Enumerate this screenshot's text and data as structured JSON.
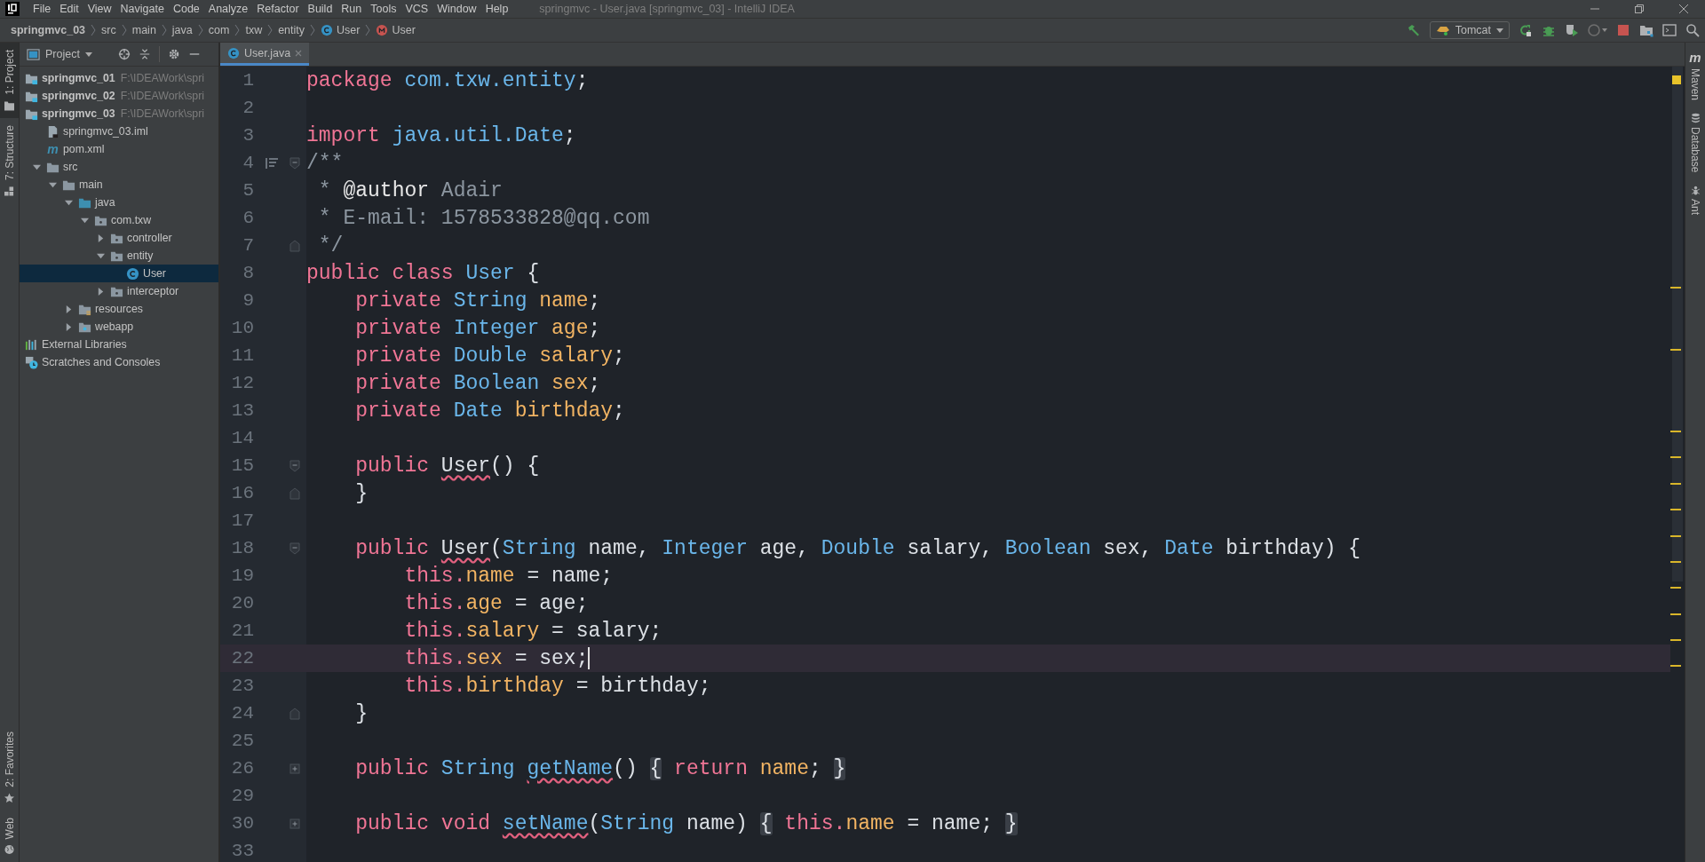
{
  "menu": [
    "File",
    "Edit",
    "View",
    "Navigate",
    "Code",
    "Analyze",
    "Refactor",
    "Build",
    "Run",
    "Tools",
    "VCS",
    "Window",
    "Help"
  ],
  "window": {
    "title": "springmvc - User.java [springmvc_03] - IntelliJ IDEA"
  },
  "breadcrumbs": [
    {
      "label": "springmvc_03",
      "kind": "project"
    },
    {
      "label": "src",
      "kind": "folder"
    },
    {
      "label": "main",
      "kind": "folder"
    },
    {
      "label": "java",
      "kind": "folder"
    },
    {
      "label": "com",
      "kind": "folder"
    },
    {
      "label": "txw",
      "kind": "folder"
    },
    {
      "label": "entity",
      "kind": "folder"
    },
    {
      "label": "User",
      "kind": "class"
    },
    {
      "label": "User",
      "kind": "method"
    }
  ],
  "run_config": {
    "label": "Tomcat"
  },
  "left_tools_top": [
    {
      "label": "1: Project",
      "kind": "project",
      "selected": true
    },
    {
      "label": "7: Structure",
      "kind": "structure",
      "selected": false
    }
  ],
  "left_tools_bottom": [
    {
      "label": "2: Favorites",
      "kind": "favorites",
      "selected": false
    },
    {
      "label": "Web",
      "kind": "web",
      "selected": false
    }
  ],
  "right_tools": [
    {
      "label": "Maven",
      "kind": "maven",
      "glyph": "m"
    },
    {
      "label": "Database",
      "kind": "database"
    },
    {
      "label": "Ant",
      "kind": "ant"
    }
  ],
  "project": {
    "title": "Project",
    "tree": [
      {
        "label": "springmvc_01",
        "path": "F:\\IDEAWork\\spri",
        "kind": "module",
        "selected": false
      },
      {
        "label": "springmvc_02",
        "path": "F:\\IDEAWork\\spri",
        "kind": "module",
        "selected": false
      },
      {
        "label": "springmvc_03",
        "path": "F:\\IDEAWork\\spri",
        "kind": "module",
        "selected": false,
        "children": [
          {
            "label": "springmvc_03.iml",
            "kind": "iml",
            "selected": false
          },
          {
            "label": "pom.xml",
            "kind": "maven",
            "glyph": "m",
            "selected": false
          },
          {
            "label": "src",
            "kind": "folder",
            "expanded": true,
            "selected": false,
            "children": [
              {
                "label": "main",
                "kind": "folder",
                "expanded": true,
                "selected": false,
                "children": [
                  {
                    "label": "java",
                    "kind": "source",
                    "expanded": true,
                    "selected": false,
                    "children": [
                      {
                        "label": "com.txw",
                        "kind": "package",
                        "expanded": true,
                        "selected": false,
                        "children": [
                          {
                            "label": "controller",
                            "kind": "package",
                            "expanded": false,
                            "selected": false
                          },
                          {
                            "label": "entity",
                            "kind": "package",
                            "expanded": true,
                            "selected": false,
                            "children": [
                              {
                                "label": "User",
                                "kind": "class",
                                "selected": true
                              }
                            ]
                          },
                          {
                            "label": "interceptor",
                            "kind": "package",
                            "expanded": false,
                            "selected": false
                          }
                        ]
                      }
                    ]
                  },
                  {
                    "label": "resources",
                    "kind": "resources",
                    "expanded": false,
                    "selected": false
                  },
                  {
                    "label": "webapp",
                    "kind": "webapp",
                    "expanded": false,
                    "selected": false
                  }
                ]
              }
            ]
          }
        ]
      },
      {
        "label": "External Libraries",
        "kind": "libraries",
        "selected": false
      },
      {
        "label": "Scratches and Consoles",
        "kind": "scratches",
        "selected": false
      }
    ]
  },
  "tabs": [
    {
      "label": "User.java",
      "selected": true
    }
  ],
  "lines": [
    {
      "number": "1",
      "kind": "plain",
      "current": false,
      "tokens": [
        {
          "text": "package ",
          "kind": "kw"
        },
        {
          "text": "com.txw.entity",
          "kind": "type"
        },
        {
          "text": ";",
          "kind": "plain"
        }
      ]
    },
    {
      "number": "2",
      "kind": "plain",
      "current": false
    },
    {
      "number": "3",
      "kind": "plain",
      "current": false,
      "tokens": [
        {
          "text": "import ",
          "kind": "kw"
        },
        {
          "text": "java.util.Date",
          "kind": "type"
        },
        {
          "text": ";",
          "kind": "plain"
        }
      ]
    },
    {
      "number": "4",
      "kind": "fold-start",
      "current": false,
      "doc_toggle": true,
      "tokens": [
        {
          "text": "/**",
          "kind": "comment"
        }
      ]
    },
    {
      "number": "5",
      "kind": "plain",
      "current": false,
      "tokens": [
        {
          "text": " * ",
          "kind": "comment"
        },
        {
          "text": "@author",
          "kind": "doctag"
        },
        {
          "text": " Adair",
          "kind": "comment"
        }
      ]
    },
    {
      "number": "6",
      "kind": "plain",
      "current": false,
      "tokens": [
        {
          "text": " * E-mail: 1578533828@qq.com",
          "kind": "comment"
        }
      ]
    },
    {
      "number": "7",
      "kind": "fold-end",
      "current": false,
      "tokens": [
        {
          "text": " */",
          "kind": "comment"
        }
      ]
    },
    {
      "number": "8",
      "kind": "plain",
      "current": false,
      "tokens": [
        {
          "text": "public class ",
          "kind": "kw"
        },
        {
          "text": "User",
          "kind": "type"
        },
        {
          "text": " {",
          "kind": "plain"
        }
      ]
    },
    {
      "number": "9",
      "kind": "plain",
      "current": false,
      "tokens": [
        {
          "text": "    private ",
          "kind": "kw"
        },
        {
          "text": "String ",
          "kind": "type"
        },
        {
          "text": "name",
          "kind": "field"
        },
        {
          "text": ";",
          "kind": "plain"
        }
      ]
    },
    {
      "number": "10",
      "kind": "plain",
      "current": false,
      "tokens": [
        {
          "text": "    private ",
          "kind": "kw"
        },
        {
          "text": "Integer ",
          "kind": "type"
        },
        {
          "text": "age",
          "kind": "field"
        },
        {
          "text": ";",
          "kind": "plain"
        }
      ]
    },
    {
      "number": "11",
      "kind": "plain",
      "current": false,
      "tokens": [
        {
          "text": "    private ",
          "kind": "kw"
        },
        {
          "text": "Double ",
          "kind": "type"
        },
        {
          "text": "salary",
          "kind": "field"
        },
        {
          "text": ";",
          "kind": "plain"
        }
      ]
    },
    {
      "number": "12",
      "kind": "plain",
      "current": false,
      "tokens": [
        {
          "text": "    private ",
          "kind": "kw"
        },
        {
          "text": "Boolean ",
          "kind": "type"
        },
        {
          "text": "sex",
          "kind": "field"
        },
        {
          "text": ";",
          "kind": "plain"
        }
      ]
    },
    {
      "number": "13",
      "kind": "plain",
      "current": false,
      "tokens": [
        {
          "text": "    private ",
          "kind": "kw"
        },
        {
          "text": "Date ",
          "kind": "type"
        },
        {
          "text": "birthday",
          "kind": "field"
        },
        {
          "text": ";",
          "kind": "plain"
        }
      ]
    },
    {
      "number": "14",
      "kind": "plain",
      "current": false
    },
    {
      "number": "15",
      "kind": "fold-start",
      "current": false,
      "tokens": [
        {
          "text": "    public ",
          "kind": "kw"
        },
        {
          "text": "User",
          "kind": "ctor"
        },
        {
          "text": "() {",
          "kind": "plain"
        }
      ]
    },
    {
      "number": "16",
      "kind": "fold-end",
      "current": false,
      "tokens": [
        {
          "text": "    }",
          "kind": "plain"
        }
      ]
    },
    {
      "number": "17",
      "kind": "plain",
      "current": false
    },
    {
      "number": "18",
      "kind": "fold-start",
      "current": false,
      "tokens": [
        {
          "text": "    public ",
          "kind": "kw"
        },
        {
          "text": "User",
          "kind": "ctor"
        },
        {
          "text": "(",
          "kind": "plain"
        },
        {
          "text": "String",
          "kind": "type"
        },
        {
          "text": " name, ",
          "kind": "plain"
        },
        {
          "text": "Integer",
          "kind": "type"
        },
        {
          "text": " age, ",
          "kind": "plain"
        },
        {
          "text": "Double",
          "kind": "type"
        },
        {
          "text": " salary, ",
          "kind": "plain"
        },
        {
          "text": "Boolean",
          "kind": "type"
        },
        {
          "text": " sex, ",
          "kind": "plain"
        },
        {
          "text": "Date",
          "kind": "type"
        },
        {
          "text": " birthday) {",
          "kind": "plain"
        }
      ]
    },
    {
      "number": "19",
      "kind": "plain",
      "current": false,
      "tokens": [
        {
          "text": "        this.",
          "kind": "kw"
        },
        {
          "text": "name",
          "kind": "field"
        },
        {
          "text": " = name;",
          "kind": "plain"
        }
      ]
    },
    {
      "number": "20",
      "kind": "plain",
      "current": false,
      "tokens": [
        {
          "text": "        this.",
          "kind": "kw"
        },
        {
          "text": "age",
          "kind": "field"
        },
        {
          "text": " = age;",
          "kind": "plain"
        }
      ]
    },
    {
      "number": "21",
      "kind": "plain",
      "current": false,
      "tokens": [
        {
          "text": "        this.",
          "kind": "kw"
        },
        {
          "text": "salary",
          "kind": "field"
        },
        {
          "text": " = salary;",
          "kind": "plain"
        }
      ]
    },
    {
      "number": "22",
      "kind": "plain",
      "current": true,
      "tokens": [
        {
          "text": "        this.",
          "kind": "kw"
        },
        {
          "text": "sex",
          "kind": "field"
        },
        {
          "text": " = sex;",
          "kind": "plain"
        }
      ]
    },
    {
      "number": "23",
      "kind": "plain",
      "current": false,
      "tokens": [
        {
          "text": "        this.",
          "kind": "kw"
        },
        {
          "text": "birthday",
          "kind": "field"
        },
        {
          "text": " = birthday;",
          "kind": "plain"
        }
      ]
    },
    {
      "number": "24",
      "kind": "fold-end",
      "current": false,
      "tokens": [
        {
          "text": "    }",
          "kind": "plain"
        }
      ]
    },
    {
      "number": "25",
      "kind": "plain",
      "current": false
    },
    {
      "number": "26",
      "kind": "fold-collapsed",
      "current": false,
      "tokens": [
        {
          "text": "    public ",
          "kind": "kw"
        },
        {
          "text": "String ",
          "kind": "type"
        },
        {
          "text": "getName",
          "kind": "method"
        },
        {
          "text": "() ",
          "kind": "plain"
        },
        {
          "text": "{",
          "kind": "brace"
        },
        {
          "text": " return ",
          "kind": "kw"
        },
        {
          "text": "name",
          "kind": "field"
        },
        {
          "text": "; ",
          "kind": "plain"
        },
        {
          "text": "}",
          "kind": "brace"
        }
      ]
    },
    {
      "number": "29",
      "kind": "plain",
      "current": false
    },
    {
      "number": "30",
      "kind": "fold-collapsed",
      "current": false,
      "tokens": [
        {
          "text": "    public void ",
          "kind": "kw"
        },
        {
          "text": "setName",
          "kind": "method"
        },
        {
          "text": "(",
          "kind": "plain"
        },
        {
          "text": "String",
          "kind": "type"
        },
        {
          "text": " name) ",
          "kind": "plain"
        },
        {
          "text": "{",
          "kind": "brace"
        },
        {
          "text": " this.",
          "kind": "kw"
        },
        {
          "text": "name",
          "kind": "field"
        },
        {
          "text": " = name; ",
          "kind": "plain"
        },
        {
          "text": "}",
          "kind": "brace"
        }
      ]
    },
    {
      "number": "33",
      "kind": "plain",
      "current": false
    }
  ]
}
